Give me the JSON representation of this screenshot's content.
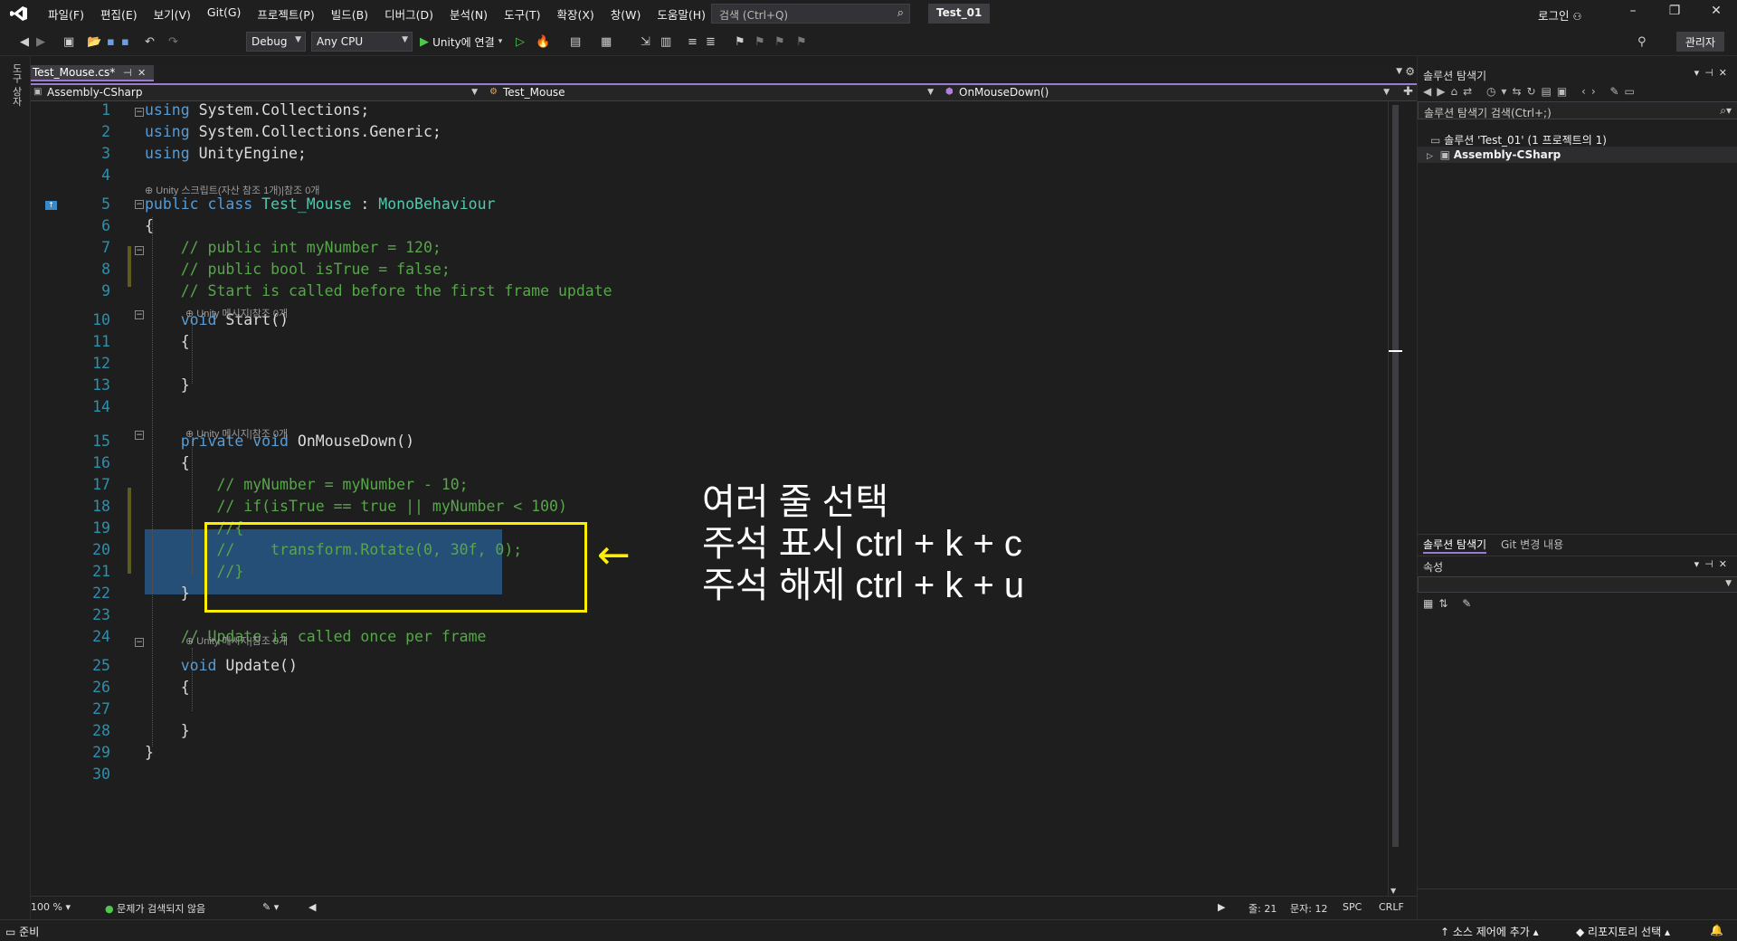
{
  "menu": [
    "파일(F)",
    "편집(E)",
    "보기(V)",
    "Git(G)",
    "프로젝트(P)",
    "빌드(B)",
    "디버그(D)",
    "분석(N)",
    "도구(T)",
    "확장(X)",
    "창(W)",
    "도움말(H)"
  ],
  "search": {
    "placeholder": "검색 (Ctrl+Q)"
  },
  "solution_name": "Test_01",
  "login": "로그인",
  "toolbar": {
    "config": "Debug",
    "platform": "Any CPU",
    "run_label": "Unity에 연결",
    "admin": "관리자"
  },
  "left_tab": "도구 상자",
  "doc_tab": {
    "title": "Test_Mouse.cs*"
  },
  "navbar": {
    "project": "Assembly-CSharp",
    "class": "Test_Mouse",
    "member": "OnMouseDown()"
  },
  "code_lens": {
    "class_lens": "Unity 스크립트(자산 참조 1개)|참조 0개",
    "start_lens": "Unity 메시지|참조 0개",
    "mousedown_lens": "Unity 메시지|참조 0개",
    "update_lens": "Unity 메시지|참조 0개"
  },
  "code_lines": [
    {
      "n": "1",
      "segs": [
        {
          "t": "using ",
          "c": "kw"
        },
        {
          "t": "System.Collections;",
          "c": ""
        }
      ]
    },
    {
      "n": "2",
      "segs": [
        {
          "t": "using ",
          "c": "kw"
        },
        {
          "t": "System.Collections.Generic;",
          "c": ""
        }
      ]
    },
    {
      "n": "3",
      "segs": [
        {
          "t": "using ",
          "c": "kw"
        },
        {
          "t": "UnityEngine;",
          "c": ""
        }
      ]
    },
    {
      "n": "4",
      "segs": []
    },
    {
      "n": "5",
      "segs": [
        {
          "t": "public class ",
          "c": "kw"
        },
        {
          "t": "Test_Mouse",
          "c": "ty"
        },
        {
          "t": " : ",
          "c": ""
        },
        {
          "t": "MonoBehaviour",
          "c": "ty"
        }
      ]
    },
    {
      "n": "6",
      "segs": [
        {
          "t": "{",
          "c": ""
        }
      ]
    },
    {
      "n": "7",
      "segs": [
        {
          "t": "    // public int myNumber = 120;",
          "c": "cm"
        }
      ]
    },
    {
      "n": "8",
      "segs": [
        {
          "t": "    // public bool isTrue = false;",
          "c": "cm"
        }
      ]
    },
    {
      "n": "9",
      "segs": [
        {
          "t": "    // Start is called before the first frame update",
          "c": "cm"
        }
      ]
    },
    {
      "n": "10",
      "segs": [
        {
          "t": "    void ",
          "c": "kw"
        },
        {
          "t": "Start",
          "c": ""
        },
        {
          "t": "()",
          "c": ""
        }
      ]
    },
    {
      "n": "11",
      "segs": [
        {
          "t": "    {",
          "c": ""
        }
      ]
    },
    {
      "n": "12",
      "segs": []
    },
    {
      "n": "13",
      "segs": [
        {
          "t": "    }",
          "c": ""
        }
      ]
    },
    {
      "n": "14",
      "segs": []
    },
    {
      "n": "15",
      "segs": [
        {
          "t": "    private void ",
          "c": "kw"
        },
        {
          "t": "OnMouseDown",
          "c": ""
        },
        {
          "t": "()",
          "c": ""
        }
      ]
    },
    {
      "n": "16",
      "segs": [
        {
          "t": "    {",
          "c": ""
        }
      ]
    },
    {
      "n": "17",
      "segs": [
        {
          "t": "        // myNumber = myNumber - 10;",
          "c": "cm"
        }
      ]
    },
    {
      "n": "18",
      "segs": [
        {
          "t": "        // if(isTrue == true || myNumber < 100)",
          "c": "cm"
        }
      ]
    },
    {
      "n": "19",
      "segs": [
        {
          "t": "        //{",
          "c": "cm"
        }
      ]
    },
    {
      "n": "20",
      "segs": [
        {
          "t": "        //    transform.Rotate(0, 30f, 0);",
          "c": "cm"
        }
      ]
    },
    {
      "n": "21",
      "segs": [
        {
          "t": "        //}",
          "c": "cm"
        }
      ]
    },
    {
      "n": "22",
      "segs": [
        {
          "t": "    }",
          "c": ""
        }
      ]
    },
    {
      "n": "23",
      "segs": []
    },
    {
      "n": "24",
      "segs": [
        {
          "t": "    // Update is called once per frame",
          "c": "cm"
        }
      ]
    },
    {
      "n": "25",
      "segs": [
        {
          "t": "    void ",
          "c": "kw"
        },
        {
          "t": "Update",
          "c": ""
        },
        {
          "t": "()",
          "c": ""
        }
      ]
    },
    {
      "n": "26",
      "segs": [
        {
          "t": "    {",
          "c": ""
        }
      ]
    },
    {
      "n": "27",
      "segs": []
    },
    {
      "n": "28",
      "segs": [
        {
          "t": "    }",
          "c": ""
        }
      ]
    },
    {
      "n": "29",
      "segs": [
        {
          "t": "}",
          "c": ""
        }
      ]
    },
    {
      "n": "30",
      "segs": []
    }
  ],
  "annotation": {
    "line1": "여러 줄 선택",
    "line2": "주석 표시 ctrl + k + c",
    "line3": "주석 해제 ctrl + k + u",
    "arrow": "←"
  },
  "editor_status": {
    "zoom": "100 %",
    "issues": "문제가 검색되지 않음",
    "line": "줄: 21",
    "col": "문자: 12",
    "spc": "SPC",
    "crlf": "CRLF"
  },
  "solution_explorer": {
    "title": "솔루션 탐색기",
    "search_placeholder": "솔루션 탐색기 검색(Ctrl+;)",
    "solution_node": "솔루션 'Test_01' (1 프로젝트의 1)",
    "project_node": "Assembly-CSharp",
    "tab1": "솔루션 탐색기",
    "tab2": "Git 변경 내용"
  },
  "properties": {
    "title": "속성"
  },
  "statusbar": {
    "ready": "준비",
    "source_control": "소스 제어에 추가",
    "repo": "리포지토리 선택"
  }
}
